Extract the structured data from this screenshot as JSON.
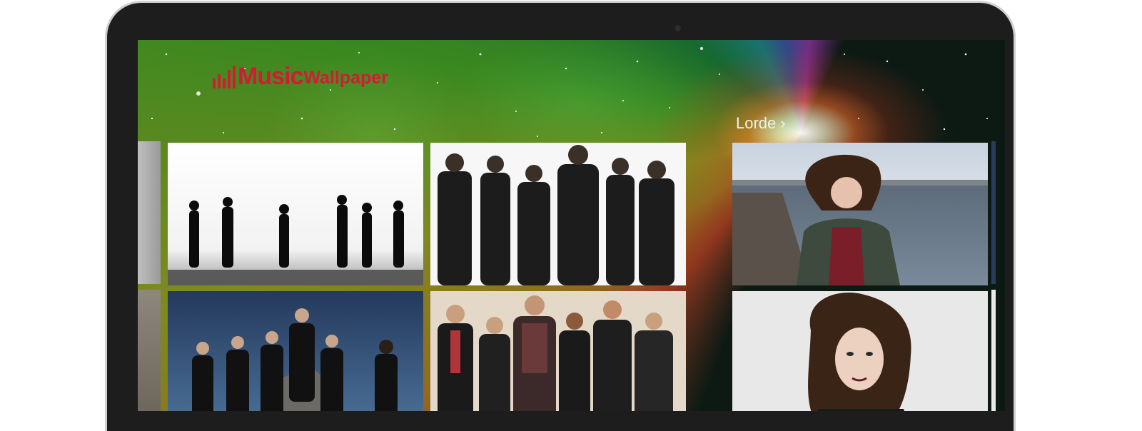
{
  "app": {
    "logo_music": "Music",
    "logo_wallpaper": "Wallpaper"
  },
  "sections": [
    {
      "title": "Lorde",
      "chevron": "›",
      "chevron_icon": "chevron-right-icon"
    }
  ],
  "colors": {
    "brand_red": "#d41b34",
    "bezel": "#1d1d1d",
    "section_title": "#f0f0f0"
  },
  "tiles": [
    {
      "name": "wallpaper-band-silhouettes",
      "group": "band"
    },
    {
      "name": "wallpaper-band-white-studio",
      "group": "band"
    },
    {
      "name": "wallpaper-band-blue-sky",
      "group": "band"
    },
    {
      "name": "wallpaper-band-color-studio",
      "group": "band"
    },
    {
      "name": "wallpaper-lorde-pier",
      "group": "Lorde"
    },
    {
      "name": "wallpaper-lorde-portrait",
      "group": "Lorde"
    }
  ]
}
